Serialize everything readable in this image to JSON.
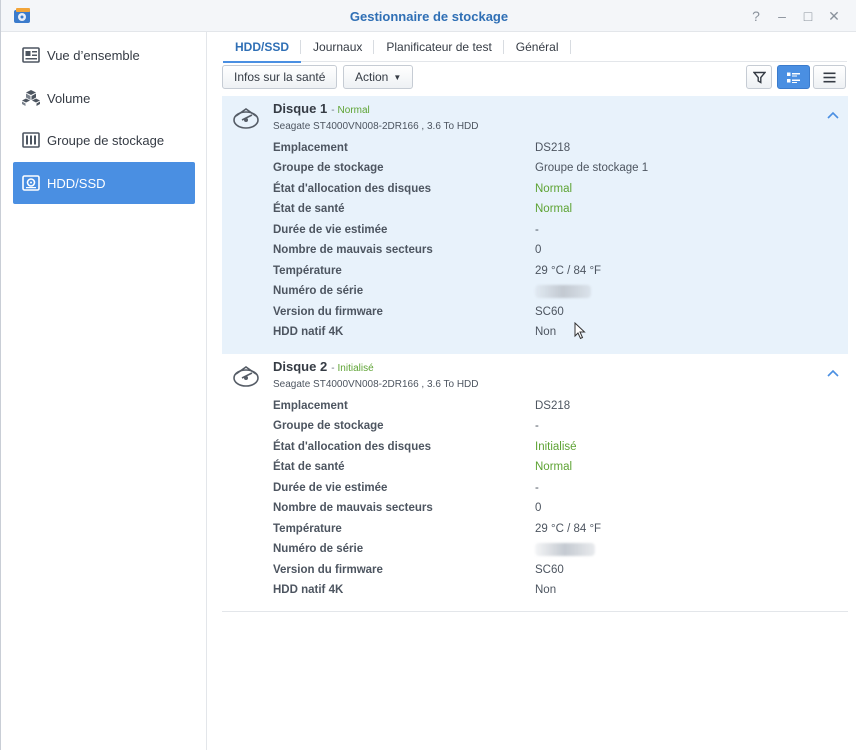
{
  "window": {
    "title": "Gestionnaire de stockage",
    "controls": [
      "?",
      "–",
      "□",
      "✕"
    ]
  },
  "sidebar": {
    "items": [
      {
        "label": "Vue d’ensemble",
        "icon": "overview-icon",
        "active": false
      },
      {
        "label": "Volume",
        "icon": "volume-icon",
        "active": false
      },
      {
        "label": "Groupe de stockage",
        "icon": "storage-pool-icon",
        "active": false
      },
      {
        "label": "HDD/SSD",
        "icon": "hdd-icon",
        "active": true
      }
    ]
  },
  "tabs": [
    {
      "label": "HDD/SSD",
      "active": true
    },
    {
      "label": "Journaux",
      "active": false
    },
    {
      "label": "Planificateur de test",
      "active": false
    },
    {
      "label": "Général",
      "active": false
    }
  ],
  "toolbar": {
    "health_button": "Infos sur la santé",
    "action_button": "Action",
    "filter_icon": "filter-icon",
    "view_detail_icon": "list-detail-icon",
    "view_list_icon": "list-icon"
  },
  "disks": [
    {
      "name": "Disque 1",
      "status": "Normal",
      "model": "Seagate ST4000VN008-2DR166 , 3.6 To HDD",
      "props": [
        {
          "key": "Emplacement",
          "value": "DS218",
          "green": false
        },
        {
          "key": "Groupe de stockage",
          "value": "Groupe de stockage 1",
          "green": false
        },
        {
          "key": "État d'allocation des disques",
          "value": "Normal",
          "green": true
        },
        {
          "key": "État de santé",
          "value": "Normal",
          "green": true
        },
        {
          "key": "Durée de vie estimée",
          "value": "-",
          "green": false
        },
        {
          "key": "Nombre de mauvais secteurs",
          "value": "0",
          "green": false
        },
        {
          "key": "Température",
          "value": "29 °C / 84 °F",
          "green": false
        },
        {
          "key": "Numéro de série",
          "value": "",
          "green": false
        },
        {
          "key": "Version du firmware",
          "value": "SC60",
          "green": false
        },
        {
          "key": "HDD natif 4K",
          "value": "Non",
          "green": false
        }
      ]
    },
    {
      "name": "Disque 2",
      "status": "Initialisé",
      "model": "Seagate ST4000VN008-2DR166 , 3.6 To HDD",
      "props": [
        {
          "key": "Emplacement",
          "value": "DS218",
          "green": false
        },
        {
          "key": "Groupe de stockage",
          "value": "-",
          "green": false
        },
        {
          "key": "État d'allocation des disques",
          "value": "Initialisé",
          "green": true
        },
        {
          "key": "État de santé",
          "value": "Normal",
          "green": true
        },
        {
          "key": "Durée de vie estimée",
          "value": "-",
          "green": false
        },
        {
          "key": "Nombre de mauvais secteurs",
          "value": "0",
          "green": false
        },
        {
          "key": "Température",
          "value": "29 °C / 84 °F",
          "green": false
        },
        {
          "key": "Numéro de série",
          "value": "",
          "green": false
        },
        {
          "key": "Version du firmware",
          "value": "SC60",
          "green": false
        },
        {
          "key": "HDD natif 4K",
          "value": "Non",
          "green": false
        }
      ]
    }
  ],
  "colors": {
    "accent": "#4a8fe2",
    "title": "#2f6fb5",
    "status_green": "#5ea334",
    "highlight_row": "#e8f2fb"
  }
}
